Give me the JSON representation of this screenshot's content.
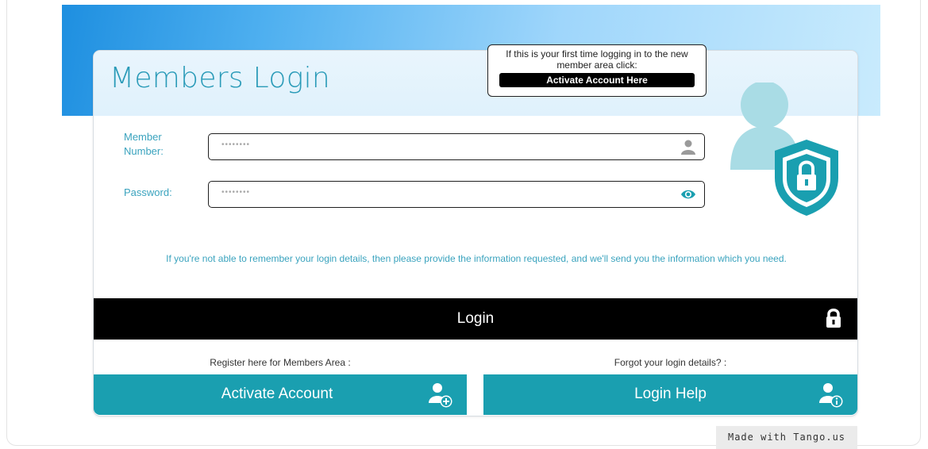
{
  "header": {
    "title": "Members Login"
  },
  "callout": {
    "text": "If this is your first time logging in to the new member area click:",
    "button_label": "Activate Account Here"
  },
  "form": {
    "member_number": {
      "label": "Member Number:",
      "value": "••••••••",
      "icon": "user-icon"
    },
    "password": {
      "label": "Password:",
      "value": "••••••••",
      "icon": "eye-icon"
    }
  },
  "info_text": "If you're not able to remember your login details, then please provide the information requested, and we'll send you the information which you need.",
  "login": {
    "label": "Login",
    "icon": "lock-icon"
  },
  "register": {
    "caption": "Register here for Members Area :",
    "button_label": "Activate Account",
    "icon": "add-user-icon"
  },
  "help": {
    "caption": "Forgot your login details? :",
    "button_label": "Login Help",
    "icon": "user-info-icon"
  },
  "watermark": "Made with Tango.us",
  "colors": {
    "accent": "#1a9fb0",
    "title": "#2a9bb8",
    "bar": "#000000",
    "deco": "#a9dce5"
  }
}
